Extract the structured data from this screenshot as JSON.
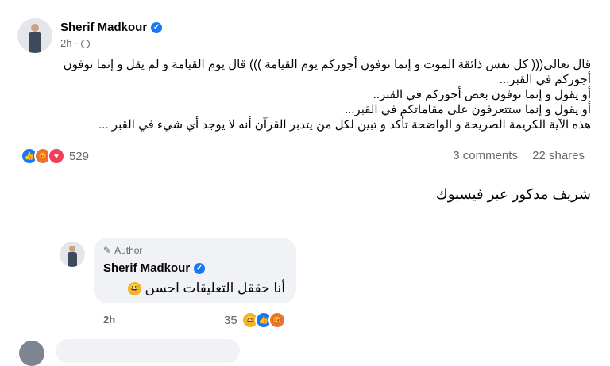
{
  "post": {
    "author": "Sherif Madkour",
    "time": "2h",
    "lines": [
      "قال تعالى((( كل نفس ذائقة الموت و إنما توفون أجوركم يوم القيامة ))) قال يوم القيامة و لم يقل و إنما توفون",
      "أجوركم في القبر...",
      "أو يقول و إنما توفون بعض أجوركم في القبر..",
      "أو يقول و إنما ستتعرفون على مقاماتكم في القبر...",
      "هذه الآية الكريمة الصريحة و الواضحة تأكد و تبين لكل من يتدبر القرآن أنه لا يوجد أي شيء في القبر ..."
    ],
    "reaction_count": "529",
    "comments": "3 comments",
    "shares": "22 shares"
  },
  "caption": "شريف مدكور عبر فيسبوك",
  "comment": {
    "tag": "Author",
    "author": "Sherif Madkour",
    "text": "أنا حققل التعليقات احسن",
    "time": "2h",
    "reaction_count": "35"
  },
  "icons": {
    "verified": "verified-badge-icon",
    "globe": "globe-icon",
    "like": "like-icon",
    "angry": "angry-icon",
    "love": "love-icon",
    "haha": "haha-icon",
    "pen": "pen-icon"
  },
  "colors": {
    "accent": "#1877f2",
    "secondary_text": "#65676b",
    "bubble": "#f0f2f5"
  }
}
